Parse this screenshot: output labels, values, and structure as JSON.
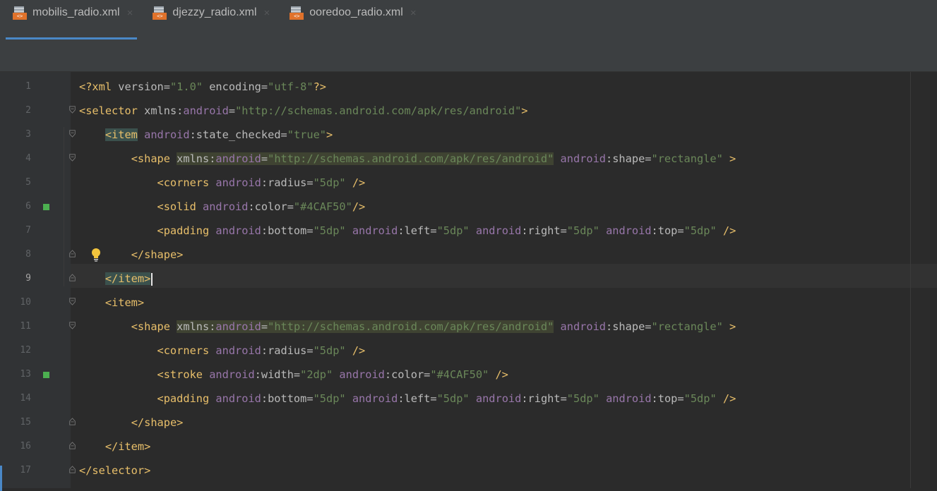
{
  "tabs": [
    {
      "label": "mobilis_radio.xml",
      "active": true,
      "icon": "xml-file-icon"
    },
    {
      "label": "djezzy_radio.xml",
      "active": false,
      "icon": "xml-file-icon"
    },
    {
      "label": "ooredoo_radio.xml",
      "active": false,
      "icon": "xml-file-icon"
    }
  ],
  "tab_close_glyph": "×",
  "icon_badge_text": "<>",
  "colors": {
    "accent": "#4a88c7",
    "color_swatch": "#4CAF50",
    "tag": "#e8bf6a",
    "value": "#6a8759",
    "namespace": "#9876aa"
  },
  "editor": {
    "current_line": 9,
    "line_numbers": [
      "1",
      "2",
      "3",
      "4",
      "5",
      "6",
      "7",
      "8",
      "9",
      "10",
      "11",
      "12",
      "13",
      "14",
      "15",
      "16",
      "17"
    ],
    "lines": [
      [
        {
          "t": "<?xml ",
          "c": "pi"
        },
        {
          "t": "version=",
          "c": "attr"
        },
        {
          "t": "\"1.0\" ",
          "c": "val"
        },
        {
          "t": "encoding=",
          "c": "attr"
        },
        {
          "t": "\"utf-8\"",
          "c": "val"
        },
        {
          "t": "?>",
          "c": "pi"
        }
      ],
      [
        {
          "t": "<selector ",
          "c": "tag"
        },
        {
          "t": "xmlns:",
          "c": "attr"
        },
        {
          "t": "android",
          "c": "ns"
        },
        {
          "t": "=",
          "c": "attr"
        },
        {
          "t": "\"http://schemas.android.com/apk/res/android\"",
          "c": "val"
        },
        {
          "t": ">",
          "c": "tag"
        }
      ],
      [
        {
          "t": "    ",
          "c": ""
        },
        {
          "t": "<item",
          "c": "tag matchtag"
        },
        {
          "t": " ",
          "c": ""
        },
        {
          "t": "android",
          "c": "ns"
        },
        {
          "t": ":state_checked=",
          "c": "attr"
        },
        {
          "t": "\"true\"",
          "c": "val"
        },
        {
          "t": ">",
          "c": "tag"
        }
      ],
      [
        {
          "t": "        ",
          "c": ""
        },
        {
          "t": "<shape ",
          "c": "tag"
        },
        {
          "t": "xmlns:",
          "c": "attr hl"
        },
        {
          "t": "android",
          "c": "ns hl"
        },
        {
          "t": "=",
          "c": "attr hl"
        },
        {
          "t": "\"http://schemas.android.com/apk/res/android\"",
          "c": "val hl"
        },
        {
          "t": " ",
          "c": ""
        },
        {
          "t": "android",
          "c": "ns"
        },
        {
          "t": ":shape=",
          "c": "attr"
        },
        {
          "t": "\"rectangle\"",
          "c": "val"
        },
        {
          "t": " >",
          "c": "tag"
        }
      ],
      [
        {
          "t": "            ",
          "c": ""
        },
        {
          "t": "<corners ",
          "c": "tag"
        },
        {
          "t": "android",
          "c": "ns"
        },
        {
          "t": ":radius=",
          "c": "attr"
        },
        {
          "t": "\"5dp\"",
          "c": "val"
        },
        {
          "t": " />",
          "c": "tag"
        }
      ],
      [
        {
          "t": "            ",
          "c": ""
        },
        {
          "t": "<solid ",
          "c": "tag"
        },
        {
          "t": "android",
          "c": "ns"
        },
        {
          "t": ":color=",
          "c": "attr"
        },
        {
          "t": "\"#4CAF50\"",
          "c": "val"
        },
        {
          "t": "/>",
          "c": "tag"
        }
      ],
      [
        {
          "t": "            ",
          "c": ""
        },
        {
          "t": "<padding ",
          "c": "tag"
        },
        {
          "t": "android",
          "c": "ns"
        },
        {
          "t": ":bottom=",
          "c": "attr"
        },
        {
          "t": "\"5dp\"",
          "c": "val"
        },
        {
          "t": " ",
          "c": ""
        },
        {
          "t": "android",
          "c": "ns"
        },
        {
          "t": ":left=",
          "c": "attr"
        },
        {
          "t": "\"5dp\"",
          "c": "val"
        },
        {
          "t": " ",
          "c": ""
        },
        {
          "t": "android",
          "c": "ns"
        },
        {
          "t": ":right=",
          "c": "attr"
        },
        {
          "t": "\"5dp\"",
          "c": "val"
        },
        {
          "t": " ",
          "c": ""
        },
        {
          "t": "android",
          "c": "ns"
        },
        {
          "t": ":top=",
          "c": "attr"
        },
        {
          "t": "\"5dp\"",
          "c": "val"
        },
        {
          "t": " />",
          "c": "tag"
        }
      ],
      [
        {
          "t": "        ",
          "c": ""
        },
        {
          "t": "</shape>",
          "c": "tag"
        }
      ],
      [
        {
          "t": "    ",
          "c": ""
        },
        {
          "t": "</item>",
          "c": "tag matchtag"
        }
      ],
      [
        {
          "t": "    ",
          "c": ""
        },
        {
          "t": "<item>",
          "c": "tag"
        }
      ],
      [
        {
          "t": "        ",
          "c": ""
        },
        {
          "t": "<shape ",
          "c": "tag"
        },
        {
          "t": "xmlns:",
          "c": "attr hl"
        },
        {
          "t": "android",
          "c": "ns hl"
        },
        {
          "t": "=",
          "c": "attr hl"
        },
        {
          "t": "\"http://schemas.android.com/apk/res/android\"",
          "c": "val hl"
        },
        {
          "t": " ",
          "c": ""
        },
        {
          "t": "android",
          "c": "ns"
        },
        {
          "t": ":shape=",
          "c": "attr"
        },
        {
          "t": "\"rectangle\"",
          "c": "val"
        },
        {
          "t": " >",
          "c": "tag"
        }
      ],
      [
        {
          "t": "            ",
          "c": ""
        },
        {
          "t": "<corners ",
          "c": "tag"
        },
        {
          "t": "android",
          "c": "ns"
        },
        {
          "t": ":radius=",
          "c": "attr"
        },
        {
          "t": "\"5dp\"",
          "c": "val"
        },
        {
          "t": " />",
          "c": "tag"
        }
      ],
      [
        {
          "t": "            ",
          "c": ""
        },
        {
          "t": "<stroke ",
          "c": "tag"
        },
        {
          "t": "android",
          "c": "ns"
        },
        {
          "t": ":width=",
          "c": "attr"
        },
        {
          "t": "\"2dp\"",
          "c": "val"
        },
        {
          "t": " ",
          "c": ""
        },
        {
          "t": "android",
          "c": "ns"
        },
        {
          "t": ":color=",
          "c": "attr"
        },
        {
          "t": "\"#4CAF50\"",
          "c": "val"
        },
        {
          "t": " />",
          "c": "tag"
        }
      ],
      [
        {
          "t": "            ",
          "c": ""
        },
        {
          "t": "<padding ",
          "c": "tag"
        },
        {
          "t": "android",
          "c": "ns"
        },
        {
          "t": ":bottom=",
          "c": "attr"
        },
        {
          "t": "\"5dp\"",
          "c": "val"
        },
        {
          "t": " ",
          "c": ""
        },
        {
          "t": "android",
          "c": "ns"
        },
        {
          "t": ":left=",
          "c": "attr"
        },
        {
          "t": "\"5dp\"",
          "c": "val"
        },
        {
          "t": " ",
          "c": ""
        },
        {
          "t": "android",
          "c": "ns"
        },
        {
          "t": ":right=",
          "c": "attr"
        },
        {
          "t": "\"5dp\"",
          "c": "val"
        },
        {
          "t": " ",
          "c": ""
        },
        {
          "t": "android",
          "c": "ns"
        },
        {
          "t": ":top=",
          "c": "attr"
        },
        {
          "t": "\"5dp\"",
          "c": "val"
        },
        {
          "t": " />",
          "c": "tag"
        }
      ],
      [
        {
          "t": "        ",
          "c": ""
        },
        {
          "t": "</shape>",
          "c": "tag"
        }
      ],
      [
        {
          "t": "    ",
          "c": ""
        },
        {
          "t": "</item>",
          "c": "tag"
        }
      ],
      [
        {
          "t": "</selector>",
          "c": "tag"
        }
      ]
    ],
    "color_swatch_lines": [
      6,
      13
    ],
    "fold_open_lines": [
      2,
      3,
      4,
      10,
      11
    ],
    "fold_close_lines": [
      8,
      9,
      15,
      16,
      17
    ],
    "intention_bulb_line": 8
  }
}
